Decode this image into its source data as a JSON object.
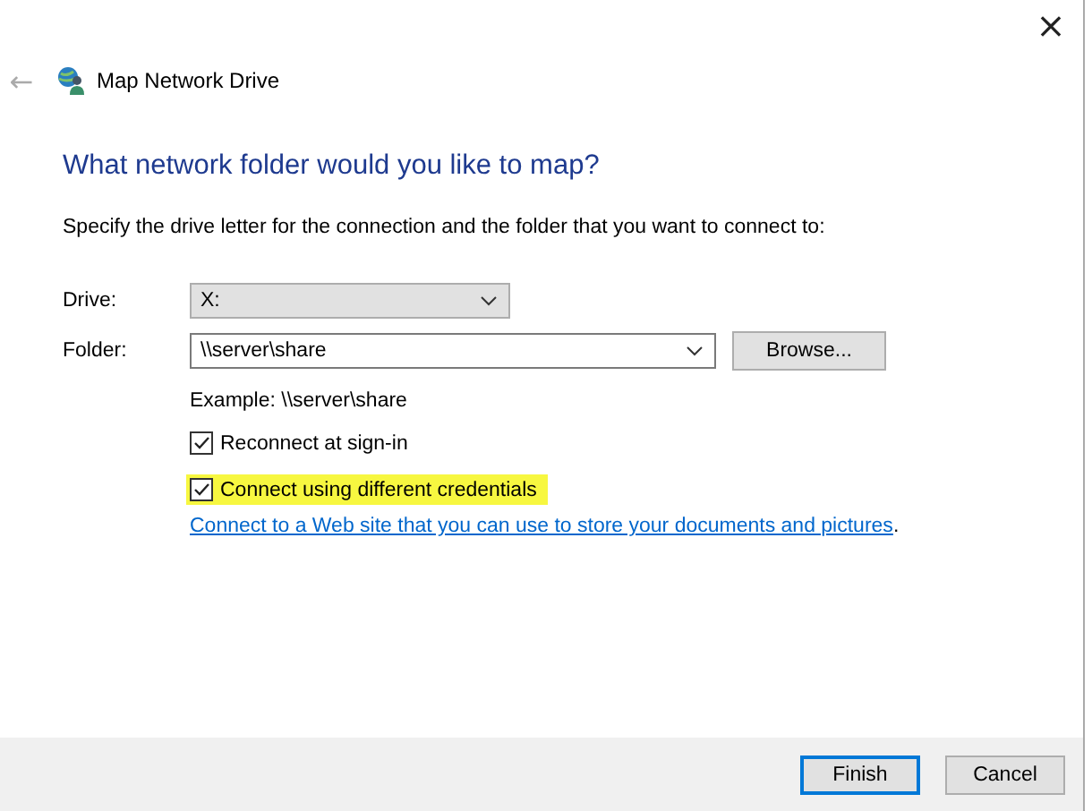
{
  "window": {
    "title": "Map Network Drive",
    "close": "×",
    "back": "←"
  },
  "heading": "What network folder would you like to map?",
  "description": "Specify the drive letter for the connection and the folder that you want to connect to:",
  "drive": {
    "label": "Drive:",
    "value": "X:"
  },
  "folder": {
    "label": "Folder:",
    "value": "\\\\server\\share",
    "button": "Browse..."
  },
  "example": "Example: \\\\server\\share",
  "options": [
    {
      "label": "Reconnect at sign-in",
      "checked": true,
      "highlighted": false
    },
    {
      "label": "Connect using different credentials",
      "checked": true,
      "highlighted": true
    }
  ],
  "link": {
    "text": "Connect to a Web site that you can use to store your documents and pictures",
    "after": "."
  },
  "buttons": [
    {
      "label": "Finish",
      "default": true
    },
    {
      "label": "Cancel",
      "default": false
    }
  ]
}
